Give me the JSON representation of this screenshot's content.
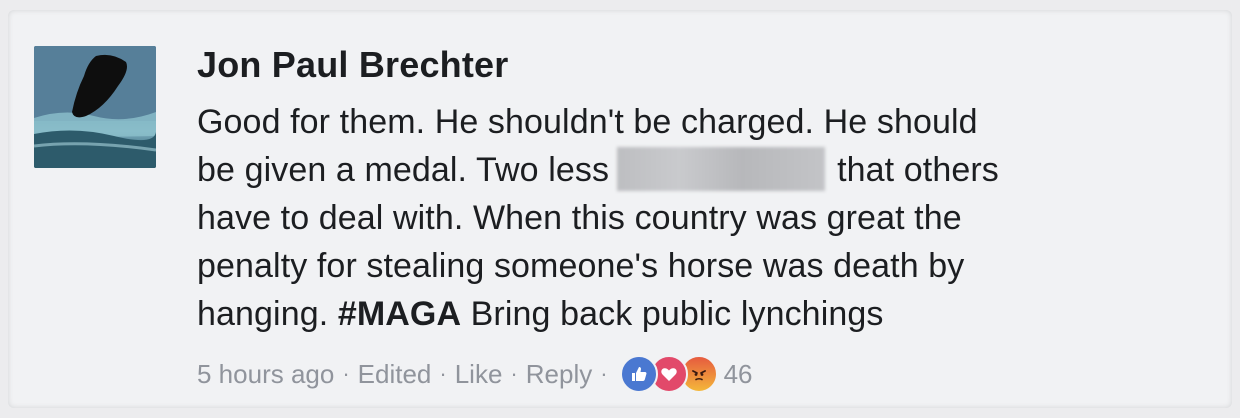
{
  "post": {
    "author": "Jon Paul Brechter",
    "lines": {
      "l1": "Good for them. He shouldn't be charged. He should",
      "l2a": "be given a medal. Two less",
      "l2b": "that others",
      "l3": "have to deal with. When this country was great the",
      "l4": "penalty for stealing someone's horse was death by",
      "l5a": "hanging.",
      "l5_hashtag": "#MAGA",
      "l5b": "Bring back public lynchings"
    }
  },
  "meta": {
    "time": "5 hours ago",
    "sep": "·",
    "edited": "Edited",
    "like": "Like",
    "reply": "Reply",
    "reaction_count": "46"
  },
  "reactions": [
    "like-icon",
    "love-icon",
    "angry-icon"
  ],
  "colors": {
    "like": "#4a78d1",
    "love": "#e2496a",
    "angry": "#e65b3f",
    "meta_text": "#90949c"
  }
}
